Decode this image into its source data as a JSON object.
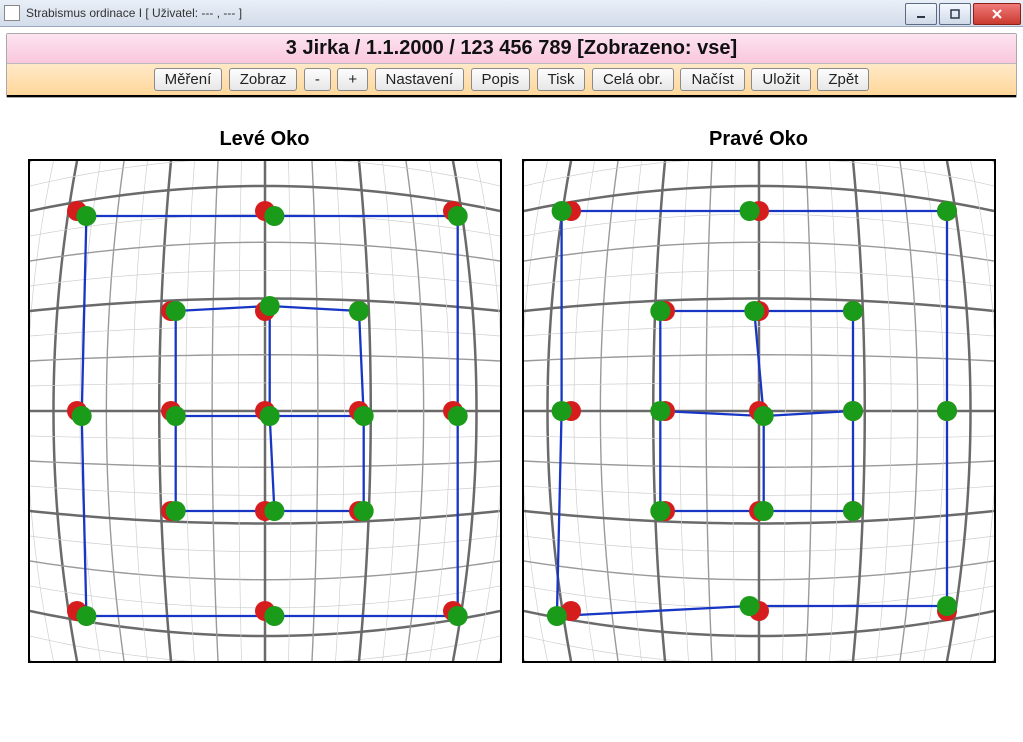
{
  "window": {
    "title": "Strabismus ordinace I [ Uživatel: --- , --- ]"
  },
  "patient_header": "3 Jirka / 1.1.2000 / 123 456 789 [Zobrazeno: vse]",
  "toolbar": {
    "measure": "Měření",
    "show": "Zobraz",
    "minus": "-",
    "plus": "+",
    "settings": "Nastavení",
    "desc": "Popis",
    "print": "Tisk",
    "fullscreen": "Celá obr.",
    "load": "Načíst",
    "save": "Uložit",
    "back": "Zpět"
  },
  "labels": {
    "left_eye": "Levé Oko",
    "right_eye": "Pravé Oko"
  },
  "chart_data": [
    {
      "type": "scatter",
      "title": "Levé Oko",
      "xlim": [
        -50,
        50
      ],
      "ylim": [
        -50,
        50
      ],
      "outer_ref": [
        [
          -40,
          40
        ],
        [
          0,
          40
        ],
        [
          40,
          40
        ],
        [
          -40,
          0
        ],
        [
          40,
          0
        ],
        [
          -40,
          -40
        ],
        [
          0,
          -40
        ],
        [
          40,
          -40
        ]
      ],
      "inner_ref": [
        [
          -20,
          20
        ],
        [
          0,
          20
        ],
        [
          20,
          20
        ],
        [
          -20,
          0
        ],
        [
          0,
          0
        ],
        [
          20,
          0
        ],
        [
          -20,
          -20
        ],
        [
          0,
          -20
        ],
        [
          20,
          -20
        ]
      ],
      "outer_meas": [
        [
          -38,
          39
        ],
        [
          2,
          39
        ],
        [
          41,
          39
        ],
        [
          -39,
          -1
        ],
        [
          41,
          -1
        ],
        [
          -38,
          -41
        ],
        [
          2,
          -41
        ],
        [
          41,
          -41
        ]
      ],
      "inner_meas": [
        [
          -19,
          20
        ],
        [
          1,
          21
        ],
        [
          20,
          20
        ],
        [
          -19,
          -1
        ],
        [
          1,
          -1
        ],
        [
          21,
          -1
        ],
        [
          -19,
          -20
        ],
        [
          2,
          -20
        ],
        [
          21,
          -20
        ]
      ],
      "ref_color": "#d61d1d",
      "meas_color": "#1a9b1a",
      "line_color": "#1836c4"
    },
    {
      "type": "scatter",
      "title": "Pravé Oko",
      "xlim": [
        -50,
        50
      ],
      "ylim": [
        -50,
        50
      ],
      "outer_ref": [
        [
          -40,
          40
        ],
        [
          0,
          40
        ],
        [
          40,
          40
        ],
        [
          -40,
          0
        ],
        [
          40,
          0
        ],
        [
          -40,
          -40
        ],
        [
          0,
          -40
        ],
        [
          40,
          -40
        ]
      ],
      "inner_ref": [
        [
          -20,
          20
        ],
        [
          0,
          20
        ],
        [
          20,
          20
        ],
        [
          -20,
          0
        ],
        [
          0,
          0
        ],
        [
          20,
          0
        ],
        [
          -20,
          -20
        ],
        [
          0,
          -20
        ],
        [
          20,
          -20
        ]
      ],
      "outer_meas": [
        [
          -42,
          40
        ],
        [
          -2,
          40
        ],
        [
          40,
          40
        ],
        [
          -42,
          0
        ],
        [
          40,
          0
        ],
        [
          -43,
          -41
        ],
        [
          -2,
          -39
        ],
        [
          40,
          -39
        ]
      ],
      "inner_meas": [
        [
          -21,
          20
        ],
        [
          -1,
          20
        ],
        [
          20,
          20
        ],
        [
          -21,
          0
        ],
        [
          1,
          -1
        ],
        [
          20,
          0
        ],
        [
          -21,
          -20
        ],
        [
          1,
          -20
        ],
        [
          20,
          -20
        ]
      ],
      "ref_color": "#d61d1d",
      "meas_color": "#1a9b1a",
      "line_color": "#1836c4"
    }
  ]
}
